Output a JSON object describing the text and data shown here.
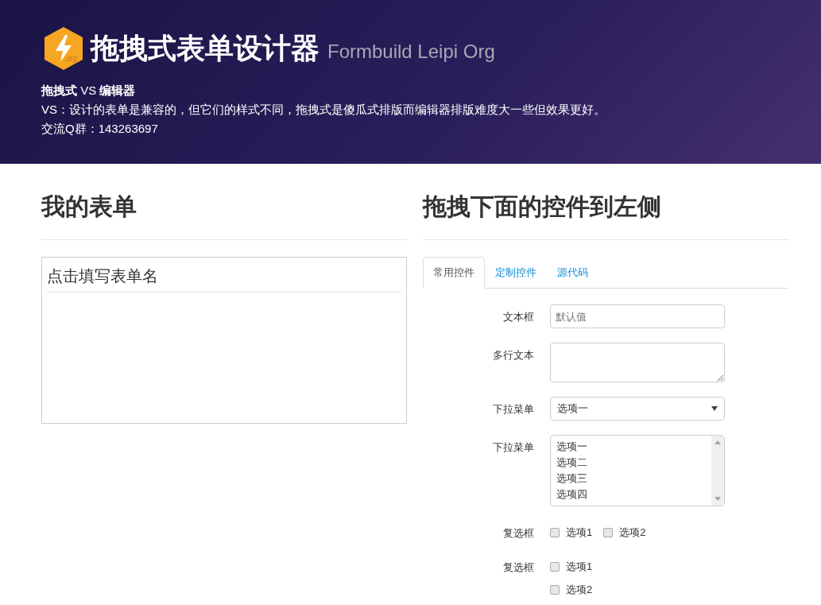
{
  "header": {
    "logo_text": ".org",
    "title": "拖拽式表单设计器",
    "subtitle": "Formbuild Leipi Org",
    "compare_title": "**拖拽式** VS **编辑器**",
    "description": "VS：设计的表单是兼容的，但它们的样式不同，拖拽式是傻瓜式排版而编辑器排版难度大一些但效果更好。",
    "contact": "交流Q群：143263697"
  },
  "left": {
    "heading": "我的表单",
    "form_name_placeholder": "点击填写表单名"
  },
  "right": {
    "heading": "拖拽下面的控件到左侧",
    "tabs": [
      {
        "label": "常用控件",
        "selected": true
      },
      {
        "label": "定制控件",
        "selected": false
      },
      {
        "label": "源代码",
        "selected": false
      }
    ],
    "controls": [
      {
        "kind": "text",
        "label": "文本框",
        "placeholder": "默认值"
      },
      {
        "kind": "textarea",
        "label": "多行文本"
      },
      {
        "kind": "select",
        "label": "下拉菜单",
        "value": "选项一"
      },
      {
        "kind": "listbox",
        "label": "下拉菜单",
        "options": [
          "选项一",
          "选项二",
          "选项三",
          "选项四"
        ]
      },
      {
        "kind": "checkbox-inline",
        "label": "复选框",
        "options": [
          {
            "label": "选项1",
            "checked": false
          },
          {
            "label": "选项2",
            "checked": false
          }
        ]
      },
      {
        "kind": "checkbox-stacked",
        "label": "复选框",
        "options": [
          {
            "label": "选项1",
            "checked": false
          },
          {
            "label": "选项2",
            "checked": false
          }
        ]
      }
    ]
  }
}
